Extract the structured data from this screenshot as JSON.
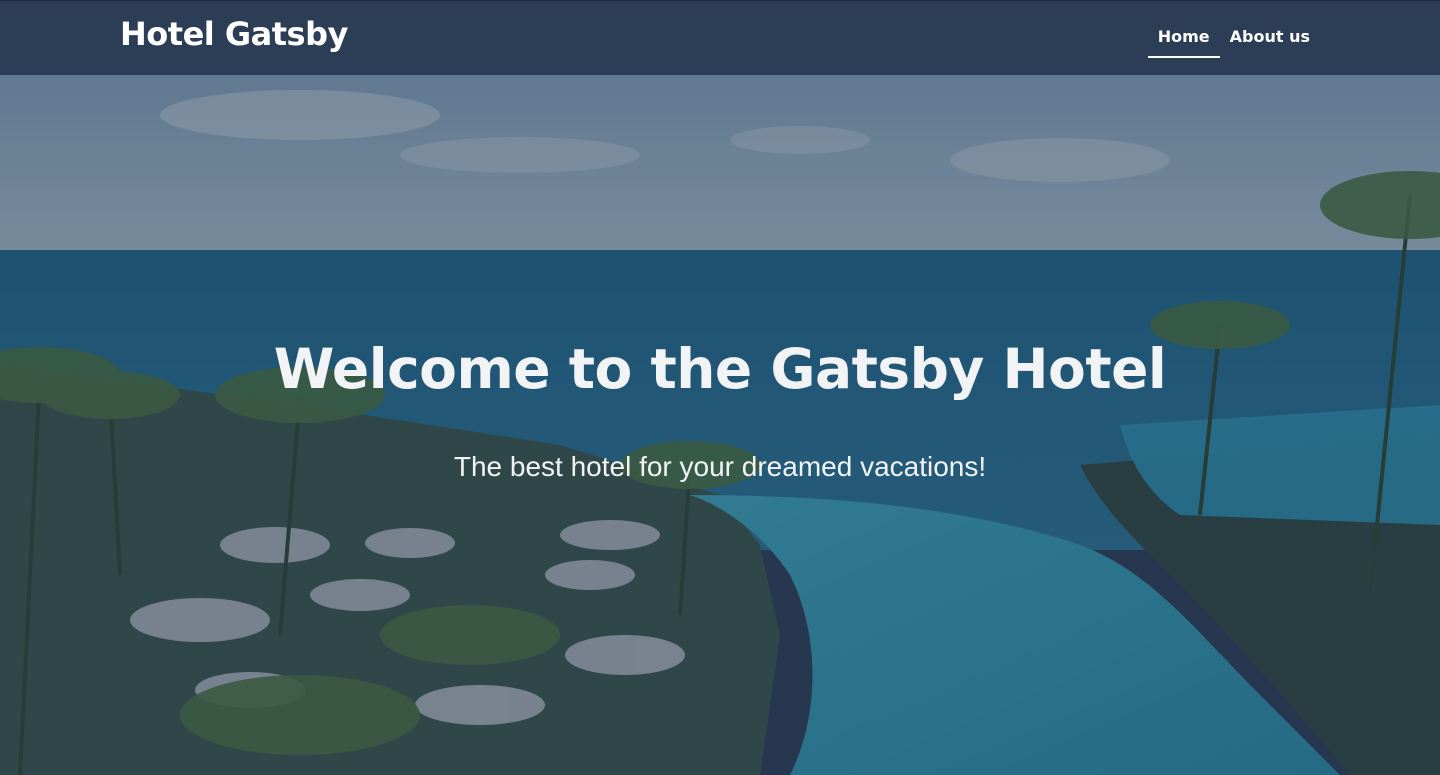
{
  "nav": {
    "brand": "Hotel Gatsby",
    "links": [
      {
        "label": "Home",
        "active": true
      },
      {
        "label": "About us",
        "active": false
      }
    ]
  },
  "hero": {
    "title": "Welcome to the Gatsby Hotel",
    "subtitle": "The best hotel for your dreamed vacations!",
    "background": "resort-pool-ocean-photo"
  },
  "colors": {
    "navbar": "#2c3e56",
    "text": "#ffffff"
  }
}
